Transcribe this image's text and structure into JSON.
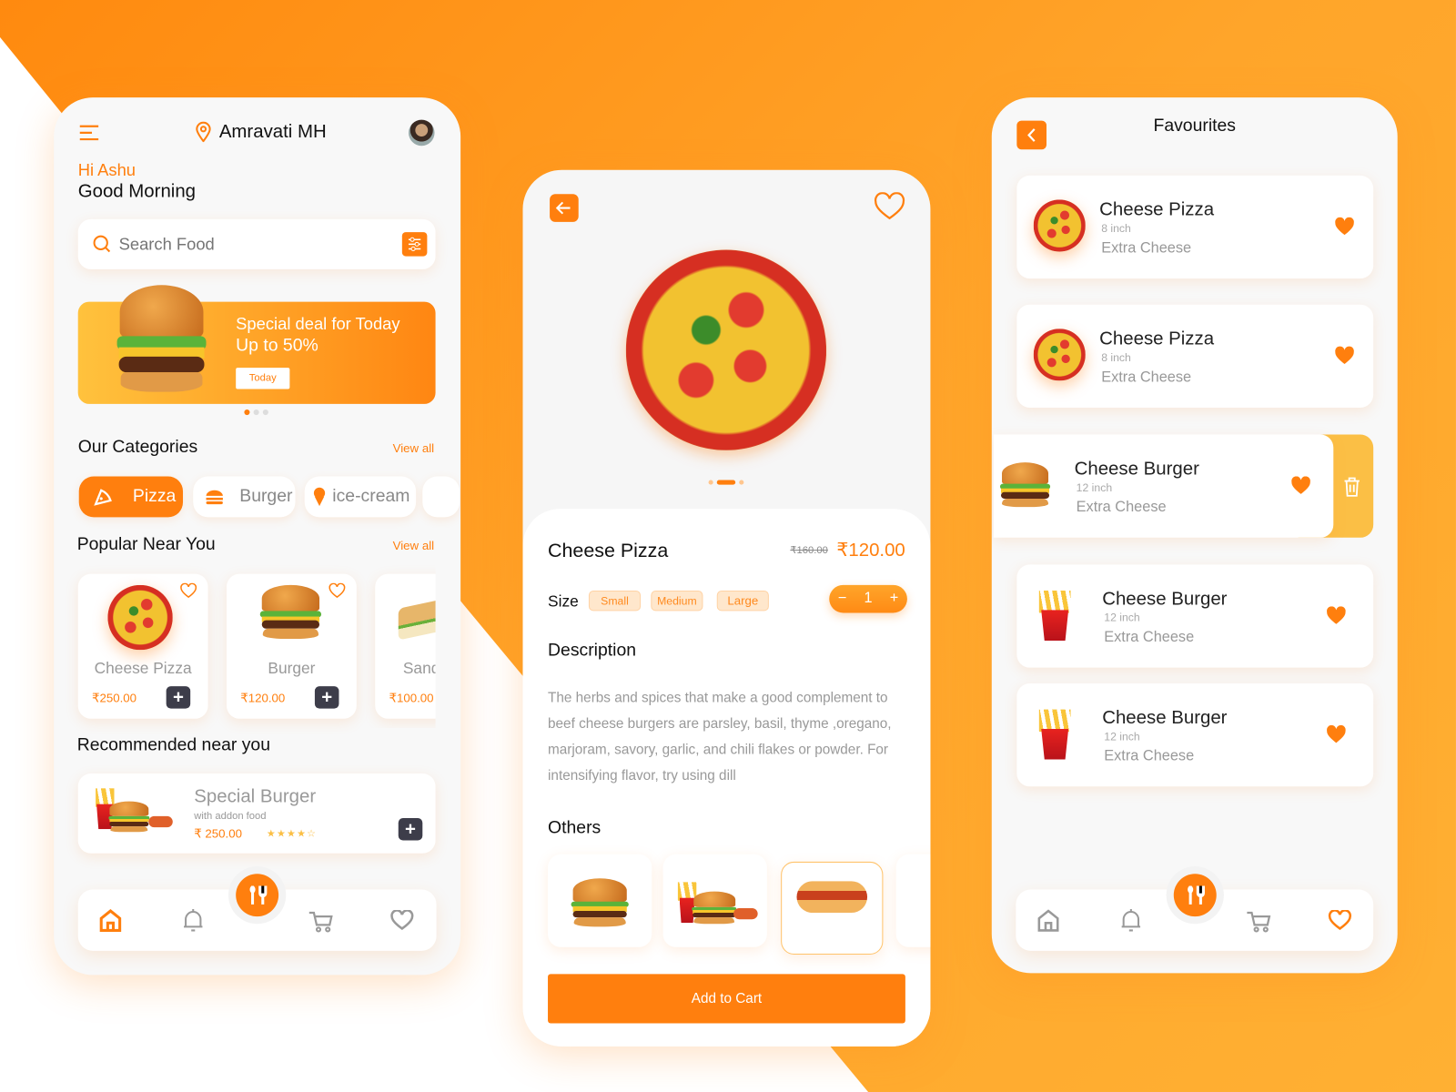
{
  "colors": {
    "accent": "#ff7f0e",
    "dark": "#3d3d4a",
    "delete": "#fbbf45"
  },
  "home": {
    "location": "Amravati MH",
    "greeting": "Hi Ashu",
    "subgreeting": "Good Morning",
    "search_placeholder": "Search Food",
    "banner": {
      "line1": "Special deal for Today",
      "line2": "Up to 50%",
      "button": "Today",
      "page": 1,
      "pages": 3
    },
    "categories_title": "Our Categories",
    "view_all": "View all",
    "categories": [
      {
        "label": "Pizza",
        "icon": "pizza-icon",
        "active": true
      },
      {
        "label": "Burger",
        "icon": "burger-icon"
      },
      {
        "label": "ice-cream",
        "icon": "ice-cream-icon"
      }
    ],
    "popular_title": "Popular Near You",
    "popular": [
      {
        "name": "Cheese Pizza",
        "price": "₹250.00"
      },
      {
        "name": "Burger",
        "price": "₹120.00"
      },
      {
        "name": "Sand",
        "price": "₹100.00"
      }
    ],
    "recommended_title": "Recommended near you",
    "recommended": {
      "name": "Special Burger",
      "sub": "with addon food",
      "price": "₹ 250.00",
      "rating": 4.5,
      "stars": "★★★★☆"
    }
  },
  "detail": {
    "title": "Cheese Pizza",
    "old_price": "₹160.00",
    "price": "₹120.00",
    "size_label": "Size",
    "sizes": [
      "Small",
      "Medium",
      "Large"
    ],
    "quantity": "1",
    "minus": "−",
    "plus": "+",
    "description_title": "Description",
    "description": "The herbs and spices that make a good complement to beef cheese burgers are parsley, basil, thyme ,oregano, marjoram, savory, garlic, and chili flakes or powder. For intensifying flavor, try using dill",
    "others_title": "Others",
    "add_to_cart": "Add to Cart"
  },
  "favourites": {
    "title": "Favourites",
    "items": [
      {
        "name": "Cheese Pizza",
        "size": "8 inch",
        "extra": "Extra Cheese"
      },
      {
        "name": "Cheese Pizza",
        "size": "8 inch",
        "extra": "Extra Cheese"
      },
      {
        "name": "Cheese Burger",
        "size": "12 inch",
        "extra": "Extra Cheese"
      },
      {
        "name": "Cheese Burger",
        "size": "12 inch",
        "extra": "Extra Cheese"
      },
      {
        "name": "Cheese Burger",
        "size": "12 inch",
        "extra": "Extra Cheese"
      }
    ]
  }
}
